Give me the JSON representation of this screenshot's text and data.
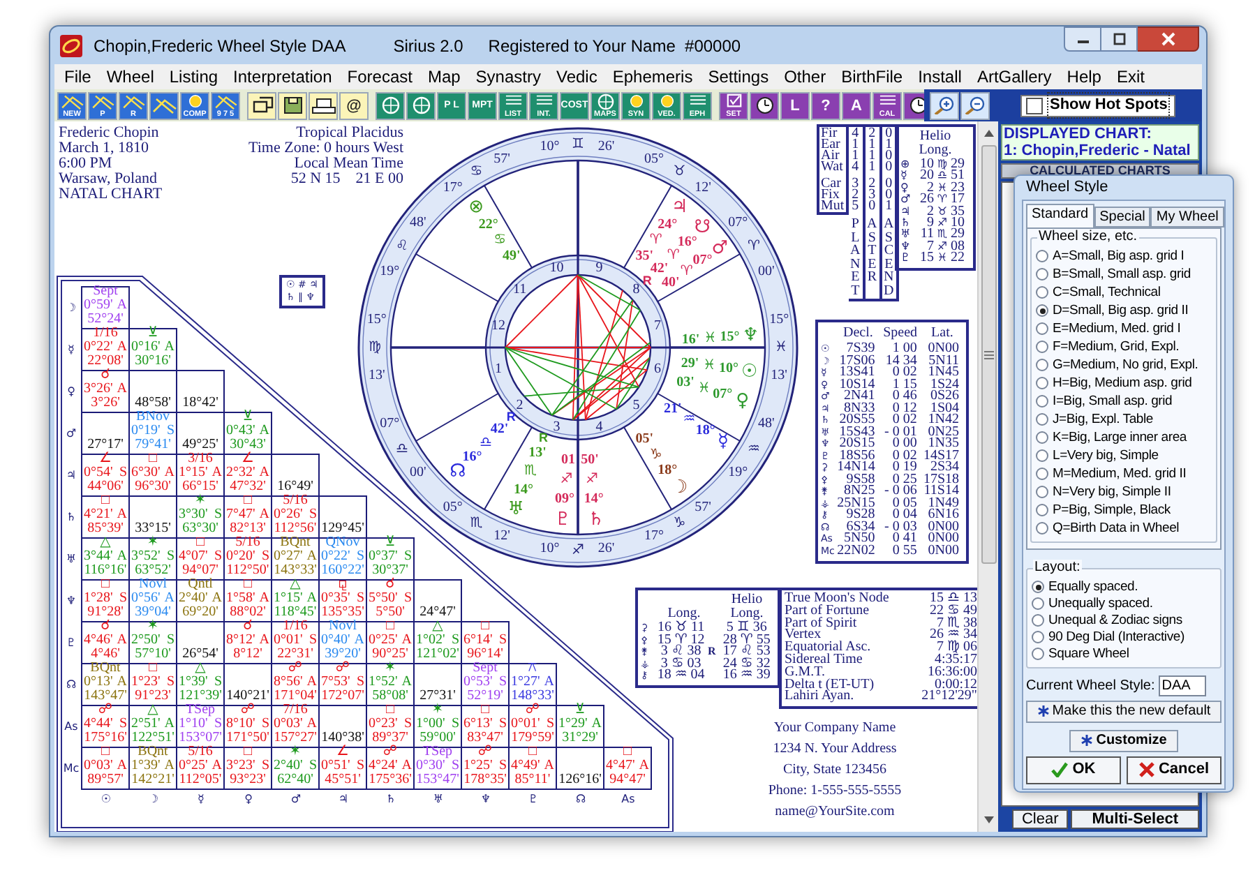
{
  "window": {
    "title": "Chopin,Frederic Wheel Style DAA",
    "app": "Sirius 2.0",
    "registration": "Registered to Your Name  #00000"
  },
  "menu": [
    "File",
    "Wheel",
    "Listing",
    "Interpretation",
    "Forecast",
    "Map",
    "Synastry",
    "Vedic",
    "Ephemeris",
    "Settings",
    "Other",
    "BirthFile",
    "Install",
    "ArtGallery",
    "Help",
    "Exit"
  ],
  "toolbar": [
    {
      "kind": "chart",
      "buttons": [
        {
          "kind": "chart",
          "label": "NEW"
        },
        {
          "kind": "chart",
          "label": "P"
        },
        {
          "kind": "chart",
          "label": "R"
        },
        {
          "kind": "chart"
        },
        {
          "kind": "sun",
          "label": "COMP"
        },
        {
          "kind": "chart",
          "label": "9 7 5"
        }
      ]
    },
    {
      "kind": "file",
      "buttons": [
        {
          "kind": "windows"
        },
        {
          "kind": "disk"
        },
        {
          "kind": "printer"
        },
        {
          "kind": "text",
          "label": "@"
        }
      ]
    },
    {
      "kind": "tools",
      "buttons": [
        {
          "kind": "wheel"
        },
        {
          "kind": "wheel"
        },
        {
          "kind": "text",
          "label": "P L"
        },
        {
          "kind": "text",
          "label": "MPT"
        },
        {
          "kind": "list",
          "label": "LIST"
        },
        {
          "kind": "list",
          "label": "INT."
        },
        {
          "kind": "text",
          "label": "COST"
        },
        {
          "kind": "wheel",
          "label": "MAPS"
        },
        {
          "kind": "sun",
          "label": "SYN"
        },
        {
          "kind": "sun",
          "label": "VED."
        },
        {
          "kind": "list",
          "label": "EPH"
        }
      ]
    },
    {
      "kind": "extras",
      "buttons": [
        {
          "kind": "check",
          "label": "SET"
        },
        {
          "kind": "clock"
        },
        {
          "kind": "text",
          "label": "L"
        },
        {
          "kind": "text",
          "label": "?"
        },
        {
          "kind": "text",
          "label": "A"
        },
        {
          "kind": "list",
          "label": "CAL"
        },
        {
          "kind": "clock"
        }
      ]
    },
    {
      "kind": "zoom",
      "buttons": [
        {
          "kind": "zoom-in"
        },
        {
          "kind": "zoom-out"
        }
      ]
    }
  ],
  "hot_spots": {
    "label": "Show Hot Spots",
    "checked": false
  },
  "birth_info": [
    "Frederic Chopin",
    "March 1, 1810",
    "6:00 PM",
    "Warsaw, Poland",
    "NATAL CHART"
  ],
  "chart_info": [
    "Tropical Placidus",
    "Time Zone: 0 hours West",
    "Local Mean Time",
    "52 N 15    21 E 00"
  ],
  "wheel": {
    "cusps": [
      {
        "degree": "15°",
        "sign": "♍",
        "minute": "13'"
      },
      {
        "degree": "07°",
        "sign": "♎",
        "minute": "00'"
      },
      {
        "degree": "05°",
        "sign": "♏",
        "minute": "12'"
      },
      {
        "degree": "10°",
        "sign": "♐",
        "minute": "26'"
      },
      {
        "degree": "17°",
        "sign": "♑",
        "minute": "57'"
      },
      {
        "degree": "19°",
        "sign": "♒",
        "minute": "48'"
      },
      {
        "degree": "15°",
        "sign": "♓",
        "minute": "13'"
      },
      {
        "degree": "07°",
        "sign": "♈",
        "minute": "00'"
      },
      {
        "degree": "05°",
        "sign": "♉",
        "minute": "12'"
      },
      {
        "degree": "10°",
        "sign": "♊",
        "minute": "26'"
      },
      {
        "degree": "17°",
        "sign": "♋",
        "minute": "57'"
      },
      {
        "degree": "19°",
        "sign": "♌",
        "minute": "48'"
      }
    ],
    "house_numbers": [
      "1",
      "2",
      "3",
      "4",
      "5",
      "6",
      "7",
      "8",
      "9",
      "10",
      "11",
      "12"
    ],
    "planets": [
      {
        "glyph": "⊗",
        "degree": "22°",
        "sign": "♋",
        "minute": "49'",
        "color": "#3c9a1e"
      },
      {
        "glyph": "♃",
        "degree": "24°",
        "sign": "♈",
        "minute": "35'",
        "color": "#d42a5a"
      },
      {
        "glyph": "☋",
        "degree": "16°",
        "sign": "♈",
        "minute": "42'",
        "retrograde_mark": "R",
        "color": "#d42a5a"
      },
      {
        "glyph": "♂",
        "degree": "07°",
        "sign": "♈",
        "minute": "40'",
        "color": "#d42a5a"
      },
      {
        "glyph": "♆",
        "degree": "15°",
        "sign": "♓",
        "minute": "16'",
        "color": "#2e9a2e"
      },
      {
        "glyph": "☉",
        "degree": "10°",
        "sign": "♓",
        "minute": "29'",
        "color": "#2e9a2e"
      },
      {
        "glyph": "♀",
        "degree": "07°",
        "sign": "♓",
        "minute": "03'",
        "color": "#2e9a2e"
      },
      {
        "glyph": "☿",
        "degree": "18°",
        "sign": "♒",
        "minute": "21'",
        "color": "#2b2bdc"
      },
      {
        "glyph": "☽",
        "degree": "18°",
        "sign": "♑",
        "minute": "05'",
        "color": "#8a3a1a"
      },
      {
        "glyph": "♇",
        "degree": "09°",
        "sign": "♐",
        "minute": "01",
        "color": "#d42a5a"
      },
      {
        "glyph": "♄",
        "degree": "14°",
        "sign": "♐",
        "minute": "50'",
        "color": "#d42a5a"
      },
      {
        "glyph": "♅",
        "degree": "14°",
        "sign": "♏",
        "minute": "13'",
        "retrograde_mark": "R",
        "color": "#3c9a1e"
      },
      {
        "glyph": "☊",
        "degree": "16°",
        "sign": "♎",
        "minute": "42'",
        "retrograde_mark": "R",
        "color": "#2b2bdc"
      }
    ]
  },
  "element_table": {
    "rows": [
      {
        "label": "Fir",
        "values": [
          "4",
          "2",
          "0"
        ]
      },
      {
        "label": "Ear",
        "values": [
          "1",
          "1",
          "1"
        ]
      },
      {
        "label": "Air",
        "values": [
          "1",
          "1",
          "0"
        ]
      },
      {
        "label": "Wat",
        "values": [
          "4",
          "1",
          "0"
        ]
      },
      {
        "label": "Car",
        "values": [
          "3",
          "2",
          "0"
        ]
      },
      {
        "label": "Fix",
        "values": [
          "2",
          "3",
          "0"
        ]
      },
      {
        "label": "Mut",
        "values": [
          "5",
          "0",
          "1"
        ]
      }
    ],
    "column_titles": [
      "PLANET",
      "ASTER",
      "ASCEND"
    ]
  },
  "helio_table": {
    "title": "Helio Long.",
    "rows": [
      {
        "glyph": "⊕",
        "degree": "10",
        "sign": "♍",
        "minute": "29"
      },
      {
        "glyph": "☿",
        "degree": "20",
        "sign": "♎",
        "minute": "51"
      },
      {
        "glyph": "♀",
        "degree": "2",
        "sign": "♓",
        "minute": "23"
      },
      {
        "glyph": "♂",
        "degree": "26",
        "sign": "♈",
        "minute": "17"
      },
      {
        "glyph": "♃",
        "degree": "2",
        "sign": "♉",
        "minute": "35"
      },
      {
        "glyph": "♄",
        "degree": "9",
        "sign": "♐",
        "minute": "10"
      },
      {
        "glyph": "♅",
        "degree": "11",
        "sign": "♏",
        "minute": "29"
      },
      {
        "glyph": "♆",
        "degree": "7",
        "sign": "♐",
        "minute": "08"
      },
      {
        "glyph": "♇",
        "degree": "15",
        "sign": "♓",
        "minute": "22"
      }
    ]
  },
  "declination_table": {
    "columns": [
      "Decl.",
      "Speed",
      "Lat."
    ],
    "rows": [
      {
        "glyph": "☉",
        "values": [
          "7S39",
          "1 00",
          "0N00"
        ]
      },
      {
        "glyph": "☽",
        "values": [
          "17S06",
          "14 34",
          "5N11"
        ]
      },
      {
        "glyph": "☿",
        "values": [
          "13S41",
          "0 02",
          "1N45"
        ]
      },
      {
        "glyph": "♀",
        "values": [
          "10S14",
          "1 15",
          "1S24"
        ]
      },
      {
        "glyph": "♂",
        "values": [
          "2N41",
          "0 46",
          "0S26"
        ]
      },
      {
        "glyph": "♃",
        "values": [
          "8N33",
          "0 12",
          "1S04"
        ]
      },
      {
        "glyph": "♄",
        "values": [
          "20S55",
          "0 02",
          "1N42"
        ]
      },
      {
        "glyph": "♅",
        "values": [
          "15S43",
          "- 0 01",
          "0N25"
        ]
      },
      {
        "glyph": "♆",
        "values": [
          "20S15",
          "0 00",
          "1N35"
        ]
      },
      {
        "glyph": "♇",
        "values": [
          "18S56",
          "0 02",
          "14S17"
        ]
      },
      {
        "glyph": "⚳",
        "values": [
          "14N14",
          "0 19",
          "2S34"
        ]
      },
      {
        "glyph": "⚴",
        "values": [
          "9S58",
          "0 25",
          "17S18"
        ]
      },
      {
        "glyph": "⚵",
        "values": [
          "8N25",
          "- 0 06",
          "11S14"
        ]
      },
      {
        "glyph": "⚶",
        "values": [
          "25N15",
          "0 05",
          "1N49"
        ]
      },
      {
        "glyph": "⚷",
        "values": [
          "9S28",
          "0 04",
          "6N16"
        ]
      },
      {
        "glyph": "☊",
        "values": [
          "6S34",
          "- 0 03",
          "0N00"
        ]
      },
      {
        "glyph": "As",
        "values": [
          "5N50",
          "0 41",
          "0N00"
        ]
      },
      {
        "glyph": "Mc",
        "values": [
          "22N02",
          "0 55",
          "0N00"
        ]
      }
    ]
  },
  "parallels": [
    "☉ # ♃",
    "♄ ∥ ♆"
  ],
  "aspect_grid": {
    "row_labels": [
      "☽",
      "☿",
      "♀",
      "♂",
      "♃",
      "♄",
      "♅",
      "♆",
      "♇",
      "☊",
      "As",
      "Mc"
    ],
    "column_labels": [
      "☉",
      "☽",
      "☿",
      "♀",
      "♂",
      "♃",
      "♄",
      "♅",
      "♆",
      "♇",
      "☊",
      "As"
    ],
    "rows": [
      [
        {
          "aspect": "Sept",
          "orb": "0°59'",
          "phase": "A",
          "angle": "52°24'",
          "color": "#a040f0"
        }
      ],
      [
        {
          "aspect": "1/16",
          "orb": "0°22'",
          "phase": "A",
          "angle": "22°08'",
          "color": "#e8161c"
        },
        {
          "aspect": "⊻",
          "orb": "0°16'",
          "phase": "A",
          "angle": "30°16'",
          "color": "#1e9a1e"
        }
      ],
      [
        {
          "aspect": "☌",
          "orb": "3°26'",
          "phase": "A",
          "angle": "3°26'",
          "color": "#e8161c"
        },
        {
          "angle": "48°58'"
        },
        {
          "angle": "18°42'"
        }
      ],
      [
        {
          "angle": "27°17'"
        },
        {
          "aspect": "BNov",
          "orb": "0°19'",
          "phase": "S",
          "angle": "79°41'",
          "color": "#2a8af0"
        },
        {
          "angle": "49°25'"
        },
        {
          "aspect": "⊻",
          "orb": "0°43'",
          "phase": "A",
          "angle": "30°43'",
          "color": "#1e9a1e"
        }
      ],
      [
        {
          "aspect": "∠",
          "orb": "0°54'",
          "phase": "S",
          "angle": "44°06'",
          "color": "#e8161c"
        },
        {
          "aspect": "□",
          "orb": "6°30'",
          "phase": "A",
          "angle": "96°30'",
          "color": "#e8161c"
        },
        {
          "aspect": "3/16",
          "orb": "1°15'",
          "phase": "A",
          "angle": "66°15'",
          "color": "#e8161c"
        },
        {
          "aspect": "∠",
          "orb": "2°32'",
          "phase": "A",
          "angle": "47°32'",
          "color": "#e8161c"
        },
        {
          "angle": "16°49'"
        }
      ],
      [
        {
          "aspect": "□",
          "orb": "4°21'",
          "phase": "A",
          "angle": "85°39'",
          "color": "#e8161c"
        },
        {
          "angle": "33°15'"
        },
        {
          "aspect": "✶",
          "orb": "3°30'",
          "phase": "S",
          "angle": "63°30'",
          "color": "#1e9a1e"
        },
        {
          "aspect": "□",
          "orb": "7°47'",
          "phase": "A",
          "angle": "82°13'",
          "color": "#e8161c"
        },
        {
          "aspect": "5/16",
          "orb": "0°26'",
          "phase": "S",
          "angle": "112°56'",
          "color": "#e8161c"
        },
        {
          "angle": "129°45'"
        }
      ],
      [
        {
          "aspect": "△",
          "orb": "3°44'",
          "phase": "A",
          "angle": "116°16'",
          "color": "#1e9a1e"
        },
        {
          "aspect": "✶",
          "orb": "3°52'",
          "phase": "S",
          "angle": "63°52'",
          "color": "#1e9a1e"
        },
        {
          "aspect": "□",
          "orb": "4°07'",
          "phase": "S",
          "angle": "94°07'",
          "color": "#e8161c"
        },
        {
          "aspect": "5/16",
          "orb": "0°20'",
          "phase": "S",
          "angle": "112°50'",
          "color": "#e8161c"
        },
        {
          "aspect": "BQnt",
          "orb": "0°27'",
          "phase": "A",
          "angle": "143°33'",
          "color": "#8c7410"
        },
        {
          "aspect": "QNov",
          "orb": "0°22'",
          "phase": "S",
          "angle": "160°22'",
          "color": "#2a8af0"
        },
        {
          "aspect": "⊻",
          "orb": "0°37'",
          "phase": "S",
          "angle": "30°37'",
          "color": "#1e9a1e"
        }
      ],
      [
        {
          "aspect": "□",
          "orb": "1°28'",
          "phase": "S",
          "angle": "91°28'",
          "color": "#e8161c"
        },
        {
          "aspect": "Novl",
          "orb": "0°56'",
          "phase": "A",
          "angle": "39°04'",
          "color": "#2a8af0"
        },
        {
          "aspect": "Qntl",
          "orb": "2°40'",
          "phase": "A",
          "angle": "69°20'",
          "color": "#8c7410"
        },
        {
          "aspect": "□",
          "orb": "1°58'",
          "phase": "A",
          "angle": "88°02'",
          "color": "#e8161c"
        },
        {
          "aspect": "△",
          "orb": "1°15'",
          "phase": "A",
          "angle": "118°45'",
          "color": "#1e9a1e"
        },
        {
          "aspect": "⚼",
          "orb": "0°35'",
          "phase": "S",
          "angle": "135°35'",
          "color": "#e8161c"
        },
        {
          "aspect": "☌",
          "orb": "5°50'",
          "phase": "S",
          "angle": "5°50'",
          "color": "#e8161c"
        },
        {
          "angle": "24°47'"
        }
      ],
      [
        {
          "aspect": "☌",
          "orb": "4°46'",
          "phase": "A",
          "angle": "4°46'",
          "color": "#e8161c"
        },
        {
          "aspect": "✶",
          "orb": "2°50'",
          "phase": "S",
          "angle": "57°10'",
          "color": "#1e9a1e"
        },
        {
          "angle": "26°54'"
        },
        {
          "aspect": "☌",
          "orb": "8°12'",
          "phase": "A",
          "angle": "8°12'",
          "color": "#e8161c"
        },
        {
          "aspect": "1/16",
          "orb": "0°01'",
          "phase": "S",
          "angle": "22°31'",
          "color": "#e8161c"
        },
        {
          "aspect": "Novl",
          "orb": "0°40'",
          "phase": "A",
          "angle": "39°20'",
          "color": "#2a8af0"
        },
        {
          "aspect": "□",
          "orb": "0°25'",
          "phase": "A",
          "angle": "90°25'",
          "color": "#e8161c"
        },
        {
          "aspect": "△",
          "orb": "1°02'",
          "phase": "S",
          "angle": "121°02'",
          "color": "#1e9a1e"
        },
        {
          "aspect": "□",
          "orb": "6°14'",
          "phase": "S",
          "angle": "96°14'",
          "color": "#e8161c"
        }
      ],
      [
        {
          "aspect": "BQnt",
          "orb": "0°13'",
          "phase": "A",
          "angle": "143°47'",
          "color": "#8c7410"
        },
        {
          "aspect": "□",
          "orb": "1°23'",
          "phase": "S",
          "angle": "91°23'",
          "color": "#e8161c"
        },
        {
          "aspect": "△",
          "orb": "1°39'",
          "phase": "S",
          "angle": "121°39'",
          "color": "#1e9a1e"
        },
        {
          "angle": "140°21'"
        },
        {
          "aspect": "☍",
          "orb": "8°56'",
          "phase": "A",
          "angle": "171°04'",
          "color": "#e8161c"
        },
        {
          "aspect": "☍",
          "orb": "7°53'",
          "phase": "S",
          "angle": "172°07'",
          "color": "#e8161c"
        },
        {
          "aspect": "✶",
          "orb": "1°52'",
          "phase": "A",
          "angle": "58°08'",
          "color": "#1e9a1e"
        },
        {
          "angle": "27°31'"
        },
        {
          "aspect": "Sept",
          "orb": "0°53'",
          "phase": "S",
          "angle": "52°19'",
          "color": "#a040f0"
        },
        {
          "aspect": "⚻",
          "orb": "1°27'",
          "phase": "A",
          "angle": "148°33'",
          "color": "#3a3ae0"
        }
      ],
      [
        {
          "aspect": "☍",
          "orb": "4°44'",
          "phase": "S",
          "angle": "175°16'",
          "color": "#e8161c"
        },
        {
          "aspect": "△",
          "orb": "2°51'",
          "phase": "A",
          "angle": "122°51'",
          "color": "#1e9a1e"
        },
        {
          "aspect": "TSep",
          "orb": "1°10'",
          "phase": "S",
          "angle": "153°07'",
          "color": "#a040f0"
        },
        {
          "aspect": "☍",
          "orb": "8°10'",
          "phase": "S",
          "angle": "171°50'",
          "color": "#e8161c"
        },
        {
          "aspect": "7/16",
          "orb": "0°03'",
          "phase": "A",
          "angle": "157°27'",
          "color": "#e8161c"
        },
        {
          "angle": "140°38'"
        },
        {
          "aspect": "□",
          "orb": "0°23'",
          "phase": "S",
          "angle": "89°37'",
          "color": "#e8161c"
        },
        {
          "aspect": "✶",
          "orb": "1°00'",
          "phase": "S",
          "angle": "59°00'",
          "color": "#1e9a1e"
        },
        {
          "aspect": "□",
          "orb": "6°13'",
          "phase": "S",
          "angle": "83°47'",
          "color": "#e8161c"
        },
        {
          "aspect": "☍",
          "orb": "0°01'",
          "phase": "S",
          "angle": "179°59'",
          "color": "#e8161c"
        },
        {
          "aspect": "⊻",
          "orb": "1°29'",
          "phase": "A",
          "angle": "31°29'",
          "color": "#1e9a1e"
        }
      ],
      [
        {
          "aspect": "□",
          "orb": "0°03'",
          "phase": "A",
          "angle": "89°57'",
          "color": "#e8161c"
        },
        {
          "aspect": "BQnt",
          "orb": "1°39'",
          "phase": "A",
          "angle": "142°21'",
          "color": "#8c7410"
        },
        {
          "aspect": "5/16",
          "orb": "0°25'",
          "phase": "A",
          "angle": "112°05'",
          "color": "#e8161c"
        },
        {
          "aspect": "□",
          "orb": "3°23'",
          "phase": "S",
          "angle": "93°23'",
          "color": "#e8161c"
        },
        {
          "aspect": "✶",
          "orb": "2°40'",
          "phase": "S",
          "angle": "62°40'",
          "color": "#1e9a1e"
        },
        {
          "aspect": "∠",
          "orb": "0°51'",
          "phase": "S",
          "angle": "45°51'",
          "color": "#e8161c"
        },
        {
          "aspect": "☍",
          "orb": "4°24'",
          "phase": "A",
          "angle": "175°36'",
          "color": "#e8161c"
        },
        {
          "aspect": "TSep",
          "orb": "0°30'",
          "phase": "S",
          "angle": "153°47'",
          "color": "#a040f0"
        },
        {
          "aspect": "☍",
          "orb": "1°25'",
          "phase": "S",
          "angle": "178°35'",
          "color": "#e8161c"
        },
        {
          "aspect": "□",
          "orb": "4°49'",
          "phase": "A",
          "angle": "85°11'",
          "color": "#e8161c"
        },
        {
          "angle": "126°16'"
        },
        {
          "aspect": "□",
          "orb": "4°47'",
          "phase": "A",
          "angle": "94°47'",
          "color": "#e8161c"
        }
      ]
    ]
  },
  "asteroid_table": {
    "columns": [
      "Long.",
      "Helio Long."
    ],
    "rows": [
      {
        "glyph": "⚳",
        "long": "16 ♉ 11",
        "helio": "5 ♊ 36"
      },
      {
        "glyph": "⚴",
        "long": "15 ♈ 12",
        "helio": "28 ♈ 55"
      },
      {
        "glyph": "⚵",
        "long": "3 ♌ 38",
        "retrograde_mark": "R",
        "helio": "17 ♌ 53"
      },
      {
        "glyph": "⚶",
        "long": "3 ♋ 03",
        "helio": "24 ♋ 32"
      },
      {
        "glyph": "⚷",
        "long": "18 ♒ 04",
        "helio": "16 ♒ 39"
      }
    ]
  },
  "points_table": [
    {
      "label": "True Moon's Node",
      "value": "15 ♎ 13"
    },
    {
      "label": "Part of Fortune",
      "value": "22 ♋ 49"
    },
    {
      "label": "Part of Spirit",
      "value": "7 ♏ 38"
    },
    {
      "label": "Vertex",
      "value": "26 ♒ 34"
    },
    {
      "label": "Equatorial Asc.",
      "value": "7 ♍ 06"
    },
    {
      "label": "Sidereal Time",
      "value": "4:35:17"
    },
    {
      "label": "G.M.T.",
      "value": "16:36:00"
    },
    {
      "label": "Delta t (ET-UT)",
      "value": "0:00:12"
    },
    {
      "label": "Lahiri Ayan.",
      "value": "21°12'29\""
    }
  ],
  "company": [
    "Your Company Name",
    "1234 N. Your Address",
    "City, State 123456",
    "Phone: 1-555-555-5555",
    "name@YourSite.com"
  ],
  "side_panel": {
    "displayed_chart_title": "DISPLAYED CHART:",
    "displayed_chart": "1: Chopin,Frederic - Natal",
    "calculated_charts_title": "CALCULATED CHARTS",
    "buttons": [
      "Clear",
      "Multi-Select"
    ]
  },
  "wheel_style_dialog": {
    "title": "Wheel Style",
    "tabs": [
      {
        "label": "Standard",
        "selected": true
      },
      {
        "label": "Special",
        "selected": false
      },
      {
        "label": "My Wheel",
        "selected": false
      }
    ],
    "size_group_title": "Wheel size, etc.",
    "size_options": [
      {
        "label": "A=Small, Big asp. grid I",
        "selected": false
      },
      {
        "label": "B=Small, Small asp. grid",
        "selected": false
      },
      {
        "label": "C=Small, Technical",
        "selected": false
      },
      {
        "label": "D=Small, Big asp. grid II",
        "selected": true
      },
      {
        "label": "E=Medium, Med. grid I",
        "selected": false
      },
      {
        "label": "F=Medium, Grid,  Expl.",
        "selected": false
      },
      {
        "label": "G=Medium, No grid, Expl.",
        "selected": false
      },
      {
        "label": "H=Big, Medium asp. grid",
        "selected": false
      },
      {
        "label": "I=Big, Small asp. grid",
        "selected": false
      },
      {
        "label": "J=Big, Expl. Table",
        "selected": false
      },
      {
        "label": "K=Big, Large inner area",
        "selected": false
      },
      {
        "label": "L=Very big, Simple",
        "selected": false
      },
      {
        "label": "M=Medium, Med. grid II",
        "selected": false
      },
      {
        "label": "N=Very big, Simple II",
        "selected": false
      },
      {
        "label": "P=Big, Simple, Black",
        "selected": false
      },
      {
        "label": "Q=Birth Data in Wheel",
        "selected": false
      }
    ],
    "layout_group_title": "Layout:",
    "layout_options": [
      {
        "label": "Equally spaced.",
        "selected": true
      },
      {
        "label": "Unequally spaced.",
        "selected": false
      },
      {
        "label": "Unequal & Zodiac signs",
        "selected": false
      },
      {
        "label": "90 Deg Dial (Interactive)",
        "selected": false
      },
      {
        "label": "Square Wheel",
        "selected": false
      }
    ],
    "current_style_label": "Current Wheel Style:",
    "current_style": "DAA",
    "default_button": "Make this the new default",
    "customize_button": "Customize",
    "ok_button": "OK",
    "cancel_button": "Cancel"
  }
}
